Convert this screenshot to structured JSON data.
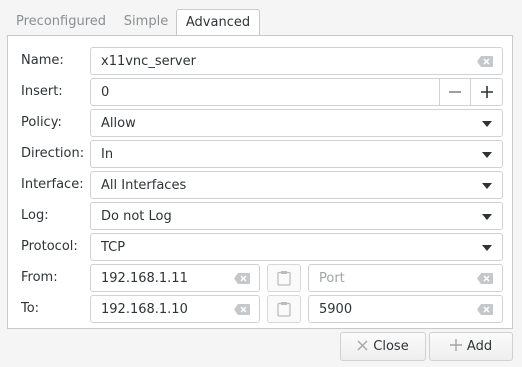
{
  "tabs": [
    {
      "label": "Preconfigured"
    },
    {
      "label": "Simple"
    },
    {
      "label": "Advanced"
    }
  ],
  "active_tab": "Advanced",
  "form": {
    "name_label": "Name:",
    "name_value": "x11vnc_server",
    "insert_label": "Insert:",
    "insert_value": "0",
    "policy_label": "Policy:",
    "policy_value": "Allow",
    "direction_label": "Direction:",
    "direction_value": "In",
    "interface_label": "Interface:",
    "interface_value": "All Interfaces",
    "log_label": "Log:",
    "log_value": "Do not Log",
    "protocol_label": "Protocol:",
    "protocol_value": "TCP",
    "from_label": "From:",
    "from_ip": "192.168.1.11",
    "from_port": "",
    "from_port_placeholder": "Port",
    "to_label": "To:",
    "to_ip": "192.168.1.10",
    "to_port": "5900"
  },
  "buttons": {
    "close_label": "Close",
    "add_label": "Add"
  },
  "icons": {
    "clear": "edit-clear-icon",
    "minus": "minus-icon",
    "plus": "plus-icon",
    "paste": "clipboard-paste-icon",
    "dropdown": "chevron-down-icon"
  }
}
